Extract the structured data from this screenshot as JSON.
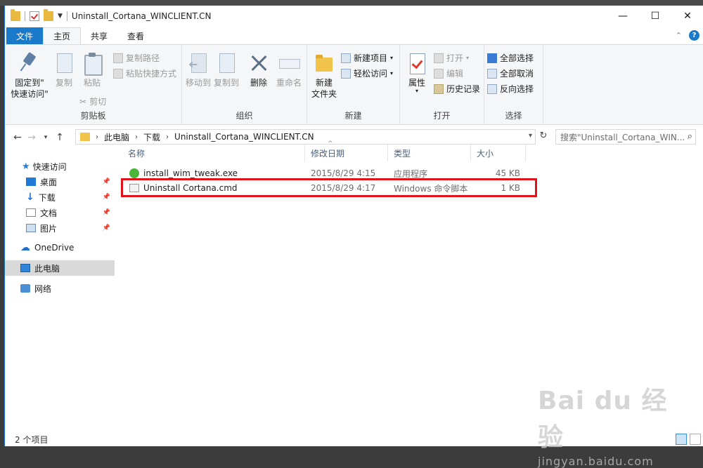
{
  "window": {
    "title": "Uninstall_Cortana_WINCLIENT.CN",
    "minimize": "—",
    "maximize": "☐",
    "close": "✕"
  },
  "tabs": [
    {
      "label": "文件"
    },
    {
      "label": "主页"
    },
    {
      "label": "共享"
    },
    {
      "label": "查看"
    }
  ],
  "ribbon": {
    "clipboard": {
      "label": "剪贴板",
      "pin_line1": "固定到\"",
      "pin_line2": "快速访问\"",
      "copy": "复制",
      "paste": "粘贴",
      "copy_path": "复制路径",
      "paste_shortcut": "粘贴快捷方式",
      "cut": "剪切"
    },
    "organize": {
      "label": "组织",
      "move_to": "移动到",
      "copy_to": "复制到",
      "delete": "删除",
      "rename": "重命名"
    },
    "new": {
      "label": "新建",
      "new_folder_line1": "新建",
      "new_folder_line2": "文件夹",
      "new_item": "新建项目",
      "easy_access": "轻松访问"
    },
    "open": {
      "label": "打开",
      "properties": "属性",
      "open": "打开",
      "edit": "编辑",
      "history": "历史记录"
    },
    "select": {
      "label": "选择",
      "select_all": "全部选择",
      "select_none": "全部取消",
      "invert": "反向选择"
    }
  },
  "address": {
    "crumbs": [
      "此电脑",
      "下载",
      "Uninstall_Cortana_WINCLIENT.CN"
    ],
    "search_placeholder": "搜索\"Uninstall_Cortana_WIN..."
  },
  "nav": {
    "quick_access": "快速访问",
    "desktop": "桌面",
    "downloads": "下载",
    "documents": "文档",
    "pictures": "图片",
    "onedrive": "OneDrive",
    "this_pc": "此电脑",
    "network": "网络"
  },
  "columns": {
    "name": "名称",
    "date": "修改日期",
    "type": "类型",
    "size": "大小"
  },
  "files": [
    {
      "name": "install_wim_tweak.exe",
      "date": "2015/8/29 4:15",
      "type": "应用程序",
      "size": "45 KB"
    },
    {
      "name": "Uninstall Cortana.cmd",
      "date": "2015/8/29 4:17",
      "type": "Windows 命令脚本",
      "size": "1 KB"
    }
  ],
  "status": {
    "count": "2 个项目"
  },
  "watermark": {
    "logo": "Bai du 经验",
    "url": "jingyan.baidu.com"
  }
}
